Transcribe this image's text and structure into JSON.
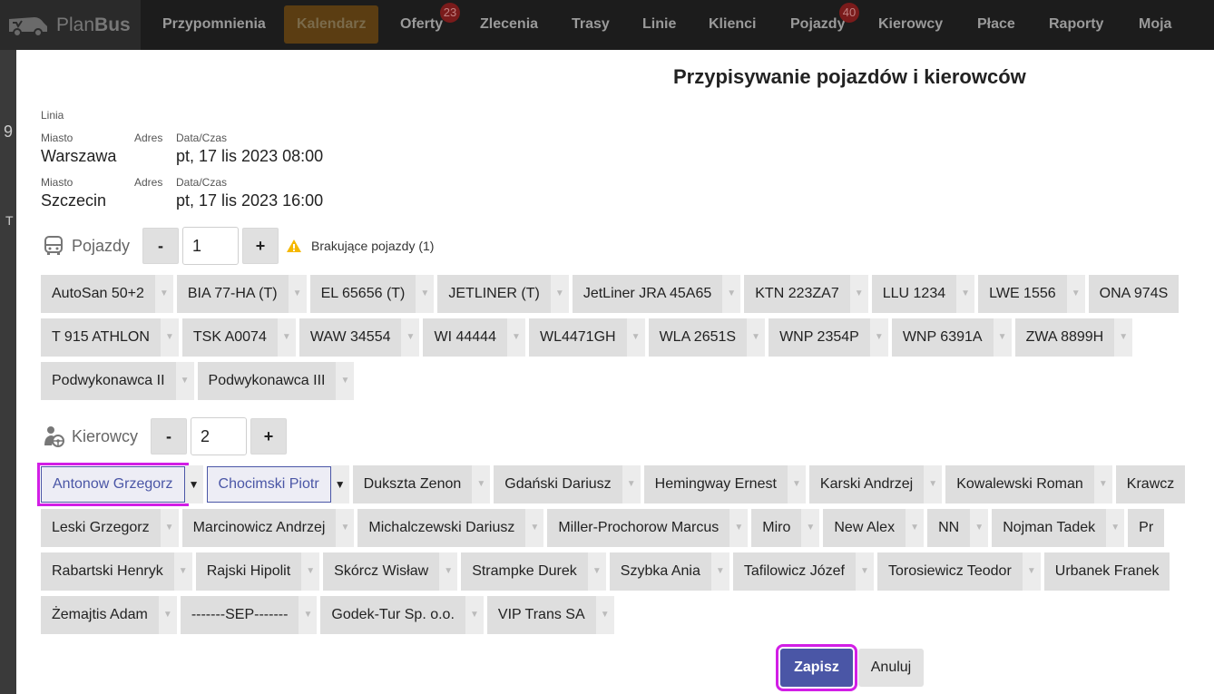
{
  "app": {
    "brand_plan": "Plan",
    "brand_bus": "Bus"
  },
  "nav": {
    "items": [
      {
        "label": "Przypomnienia"
      },
      {
        "label": "Kalendarz",
        "active": true
      },
      {
        "label": "Oferty",
        "badge": "23"
      },
      {
        "label": "Zlecenia"
      },
      {
        "label": "Trasy"
      },
      {
        "label": "Linie"
      },
      {
        "label": "Klienci"
      },
      {
        "label": "Pojazdy",
        "badge": "40"
      },
      {
        "label": "Kierowcy"
      },
      {
        "label": "Płace"
      },
      {
        "label": "Raporty"
      },
      {
        "label": "Moja firma"
      }
    ]
  },
  "background": {
    "char1": "9",
    "char2": "T"
  },
  "modal": {
    "title": "Przypisywanie pojazdów i kierowców",
    "line_label": "Linia",
    "stops": [
      {
        "city_label": "Miasto",
        "city": "Warszawa",
        "address_label": "Adres",
        "datetime_label": "Data/Czas",
        "datetime": "pt, 17 lis 2023 08:00"
      },
      {
        "city_label": "Miasto",
        "city": "Szczecin",
        "address_label": "Adres",
        "datetime_label": "Data/Czas",
        "datetime": "pt, 17 lis 2023 16:00"
      }
    ],
    "vehicles": {
      "label": "Pojazdy",
      "minus": "-",
      "count": "1",
      "plus": "+",
      "warning": "Brakujące pojazdy (1)",
      "rows": [
        [
          "AutoSan 50+2",
          "BIA 77-HA (T)",
          "EL 65656 (T)",
          "JETLINER (T)",
          "JetLiner JRA 45A65",
          "KTN 223ZA7",
          "LLU 1234",
          "LWE 1556",
          "ONA 974S"
        ],
        [
          "T 915 ATHLON",
          "TSK A0074",
          "WAW 34554",
          "WI 44444",
          "WL4471GH",
          "WLA 2651S",
          "WNP 2354P",
          "WNP 6391A",
          "ZWA 8899H"
        ],
        [
          "Podwykonawca II",
          "Podwykonawca III"
        ]
      ]
    },
    "drivers": {
      "label": "Kierowcy",
      "minus": "-",
      "count": "2",
      "plus": "+",
      "selected": [
        "Antonow Grzegorz",
        "Chocimski Piotr"
      ],
      "rows": [
        [
          "Antonow Grzegorz",
          "Chocimski Piotr",
          "Dukszta Zenon",
          "Gdański Dariusz",
          "Hemingway Ernest",
          "Karski Andrzej",
          "Kowalewski Roman",
          "Krawcz"
        ],
        [
          "Leski Grzegorz",
          "Marcinowicz Andrzej",
          "Michalczewski Dariusz",
          "Miller-Prochorow Marcus",
          "Miro",
          "New Alex",
          "NN",
          "Nojman Tadek",
          "Pr"
        ],
        [
          "Rabartski Henryk",
          "Rajski Hipolit",
          "Skórcz Wisław",
          "Strampke Durek",
          "Szybka Ania",
          "Tafilowicz Józef",
          "Torosiewicz Teodor",
          "Urbanek Franek"
        ],
        [
          "Żemajtis Adam",
          "-------SEP-------",
          "Godek-Tur Sp. o.o.",
          "VIP Trans SA"
        ]
      ]
    },
    "save_label": "Zapisz",
    "cancel_label": "Anuluj"
  }
}
